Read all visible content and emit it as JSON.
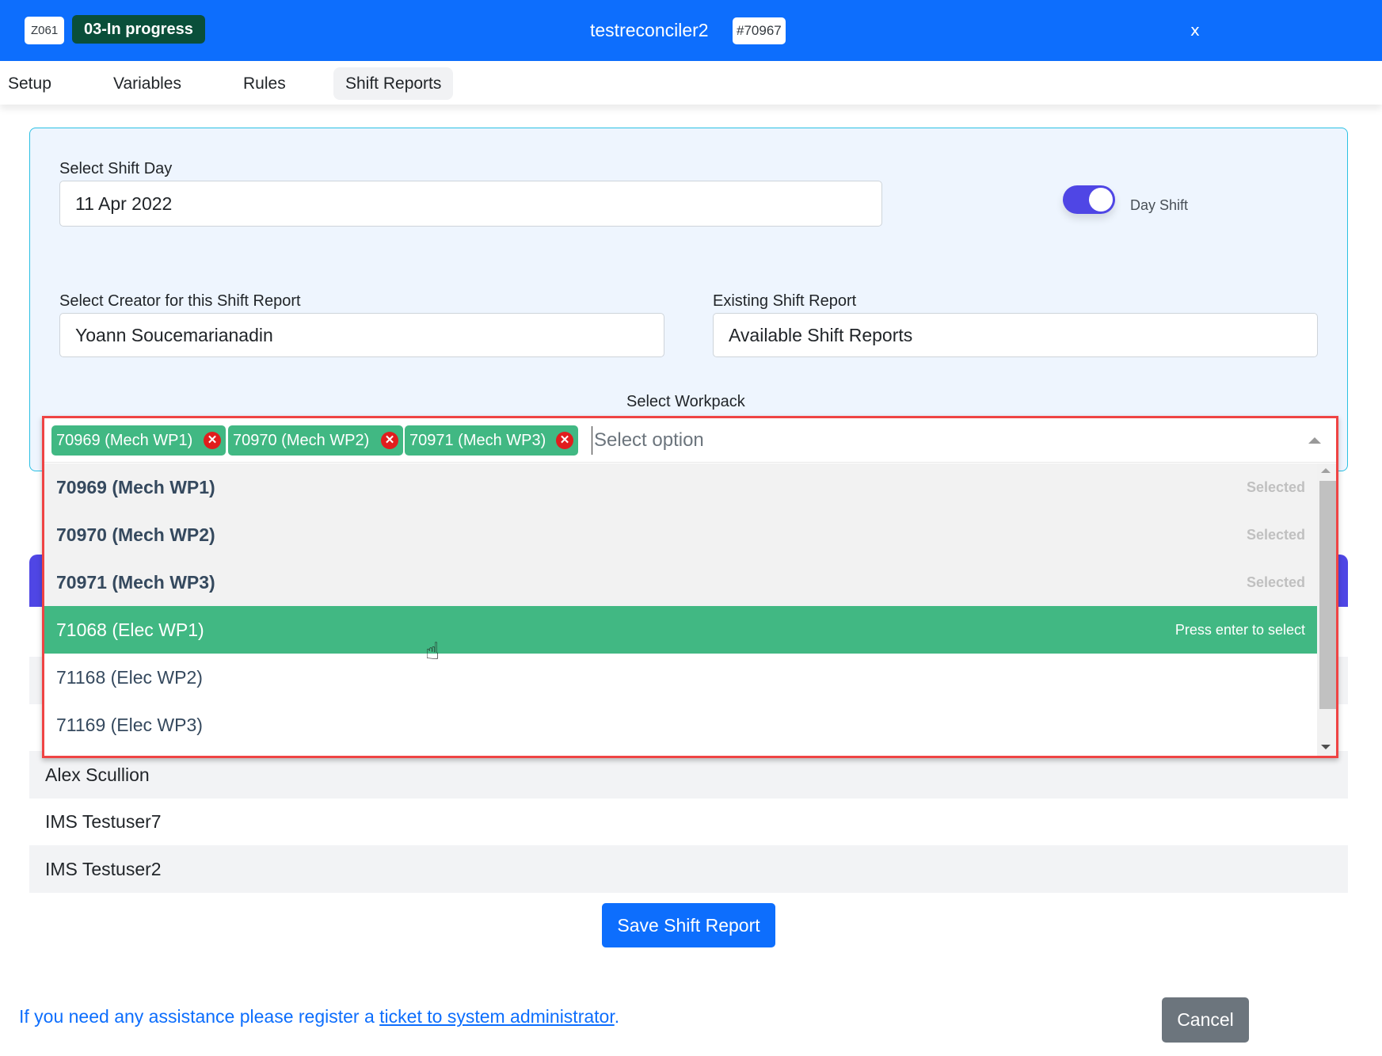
{
  "header": {
    "code_badge": "Z061",
    "status_badge": "03-In progress",
    "title": "testreconciler2",
    "id_badge": "#70967",
    "close_label": "x"
  },
  "nav": {
    "tabs": [
      {
        "label": "Setup",
        "active": false
      },
      {
        "label": "Variables",
        "active": false
      },
      {
        "label": "Rules",
        "active": false
      },
      {
        "label": "Shift Reports",
        "active": true
      }
    ]
  },
  "form": {
    "shift_day_label": "Select Shift Day",
    "shift_day_value": "11 Apr 2022",
    "toggle_label": "Day Shift",
    "toggle_on": true,
    "creator_label": "Select Creator for this Shift Report",
    "creator_value": "Yoann Soucemarianadin",
    "existing_label": "Existing Shift Report",
    "existing_value": "Available Shift Reports",
    "workpack_label": "Select Workpack"
  },
  "workpack": {
    "selected_tags": [
      "70969 (Mech WP1)",
      "70970 (Mech WP2)",
      "70971 (Mech WP3)"
    ],
    "placeholder": "Select option",
    "options": [
      {
        "label": "70969 (Mech WP1)",
        "state": "selected",
        "hint": "Selected"
      },
      {
        "label": "70970 (Mech WP2)",
        "state": "selected",
        "hint": "Selected"
      },
      {
        "label": "70971 (Mech WP3)",
        "state": "selected",
        "hint": "Selected"
      },
      {
        "label": "71068 (Elec WP1)",
        "state": "highlight",
        "hint": "Press enter to select"
      },
      {
        "label": "71168 (Elec WP2)",
        "state": "normal",
        "hint": ""
      },
      {
        "label": "71169 (Elec WP3)",
        "state": "normal",
        "hint": ""
      }
    ]
  },
  "users": [
    "Alex Scullion",
    "IMS Testuser7",
    "IMS Testuser2"
  ],
  "actions": {
    "save_label": "Save Shift Report",
    "cancel_label": "Cancel"
  },
  "footer": {
    "text_before": "If you need any assistance please register a ",
    "link_text": "ticket to system administrator",
    "text_after": "."
  },
  "colors": {
    "primary": "#0d6efd",
    "status_badge": "#0a4f3a",
    "tag_green": "#41b883",
    "toggle": "#4f46e5",
    "highlight_border": "#ef4444",
    "secondary": "#6c757d"
  }
}
